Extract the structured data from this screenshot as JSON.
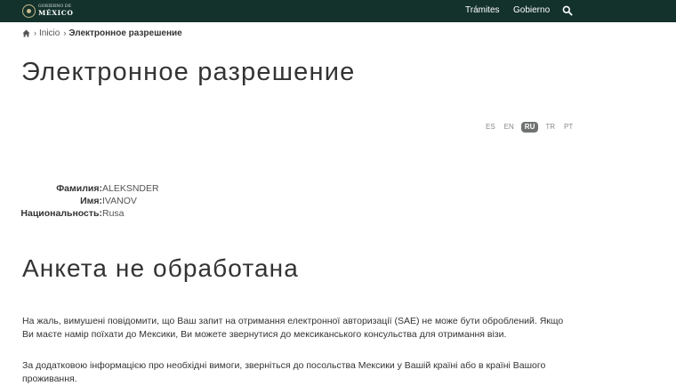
{
  "header": {
    "logo_line1": "GOBIERNO DE",
    "logo_line2": "MÉXICO",
    "nav": [
      "Trámites",
      "Gobierno"
    ],
    "search_icon": "search-icon"
  },
  "breadcrumb": {
    "home_icon": "home-icon",
    "separator": "›",
    "inicio": "Inicio",
    "current": "Электронное разрешение"
  },
  "page_title": "Электронное разрешение",
  "languages": [
    {
      "code": "ES",
      "active": false
    },
    {
      "code": "EN",
      "active": false
    },
    {
      "code": "RU",
      "active": true
    },
    {
      "code": "TR",
      "active": false
    },
    {
      "code": "PT",
      "active": false
    }
  ],
  "applicant": {
    "surname_label": "Фамилия:",
    "surname": "ALEKSNDER",
    "name_label": "Имя:",
    "name": "IVANOV",
    "nationality_label": "Национальность:",
    "nationality": "Rusa"
  },
  "status_title": "Анкета не обработана",
  "message": {
    "p1": "На жаль, вимушені повідомити, що Ваш запит на отримання електронної авторизації (SAE) не може бути оброблений. Якщо Ви маєте намір поїхати до Мексики, Ви можете звернутися до мексиканського консульства для отримання візи.",
    "p2": "За додатковою інформацією про необхідні вимоги, зверніться до посольства Мексики у Вашій країні або в країні Вашого проживання."
  },
  "colors": {
    "header_bg": "#13322b",
    "text": "#333333",
    "active_lang_bg": "#6f7271"
  }
}
